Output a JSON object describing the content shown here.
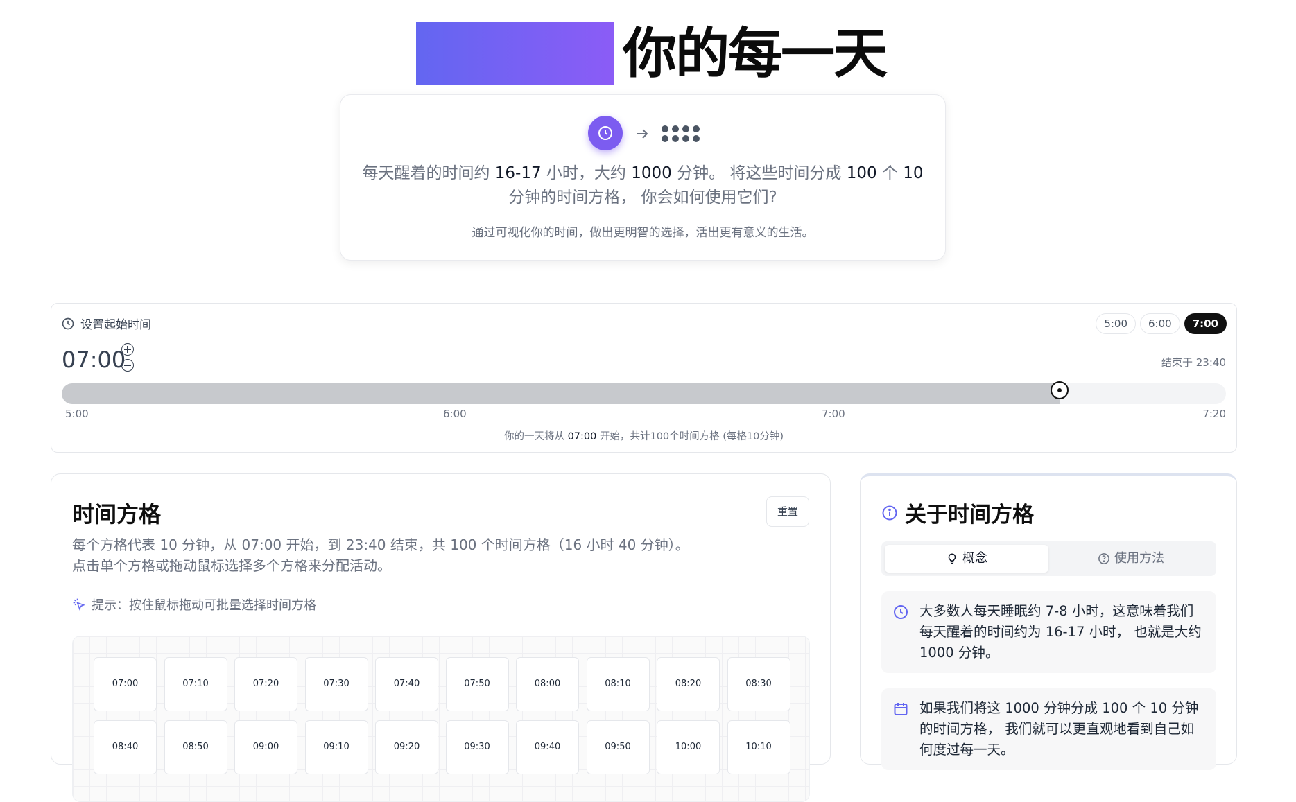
{
  "hero": {
    "title": "你的每一天"
  },
  "intro": {
    "line1_a": "每天醒着的时间约 ",
    "line1_b": "16-17",
    "line1_c": " 小时，大约 ",
    "line1_d": "1000",
    "line1_e": " 分钟。 将这些时间分成 ",
    "line1_f": "100",
    "line1_g": " 个 ",
    "line1_h": "10",
    "line1_i": " 分钟的时间方格， 你会如何使用它们?",
    "subtitle": "通过可视化你的时间，做出更明智的选择，活出更有意义的生活。"
  },
  "start_time": {
    "label": "设置起始时间",
    "presets": [
      "5:00",
      "6:00",
      "7:00"
    ],
    "active_preset": "7:00",
    "value": "07:00",
    "end_label": "结束于 23:40",
    "slider_min": "5:00",
    "slider_max": "7:20",
    "slider_value_fraction": 0.857,
    "ticks": [
      "5:00",
      "6:00",
      "7:00",
      "7:20"
    ],
    "summary_a": "你的一天将从 ",
    "summary_b": "07:00",
    "summary_c": " 开始，共计100个时间方格 (每格10分钟)"
  },
  "grid": {
    "title": "时间方格",
    "reset_label": "重置",
    "desc_line1": "每个方格代表 10 分钟，从 07:00 开始，到 23:40 结束，共 100 个时间方格（16 小时 40 分钟）。",
    "desc_line2": "点击单个方格或拖动鼠标选择多个方格来分配活动。",
    "hint": "提示：按住鼠标拖动可批量选择时间方格",
    "cells": [
      "07:00",
      "07:10",
      "07:20",
      "07:30",
      "07:40",
      "07:50",
      "08:00",
      "08:10",
      "08:20",
      "08:30",
      "08:40",
      "08:50",
      "09:00",
      "09:10",
      "09:20",
      "09:30",
      "09:40",
      "09:50",
      "10:00",
      "10:10"
    ]
  },
  "about": {
    "title": "关于时间方格",
    "tabs": [
      "概念",
      "使用方法"
    ],
    "active_tab": "概念",
    "box1": "大多数人每天睡眠约 7-8 小时，这意味着我们每天醒着的时间约为 16-17 小时， 也就是大约 1000 分钟。",
    "box2": "如果我们将这 1000 分钟分成 100 个 10 分钟的时间方格， 我们就可以更直观地看到自己如何度过每一天。"
  },
  "colors": {
    "accent": "#7c5cf0",
    "gradient_start": "#6366f1",
    "gradient_end": "#8b5cf6"
  }
}
